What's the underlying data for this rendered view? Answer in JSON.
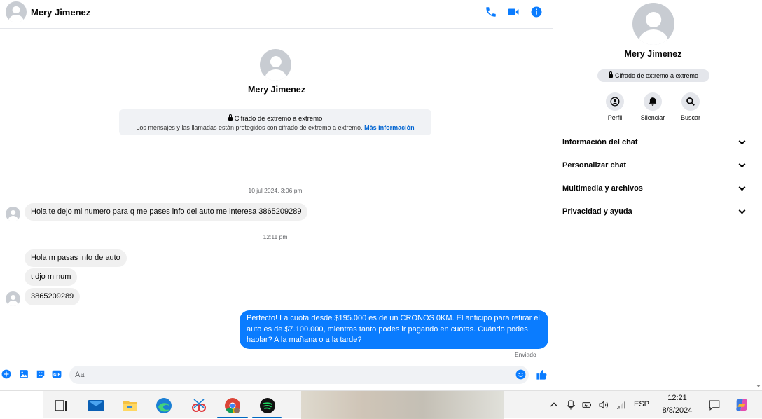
{
  "header": {
    "contact_name": "Mery Jimenez"
  },
  "chat": {
    "profile_name": "Mery Jimenez",
    "e2e_title": "Cifrado de extremo a extremo",
    "e2e_desc": "Los mensajes y las llamadas están protegidos con cifrado de extremo a extremo.",
    "e2e_link": "Más información",
    "timestamp1": "10 jul 2024, 3:06 pm",
    "timestamp2": "12:11 pm",
    "messages_in": [
      "Hola te dejo mi numero para q me pases  info del auto me interesa 3865209289",
      "Hola m pasas info de auto",
      "t djo m num",
      "3865209289"
    ],
    "message_out": "Perfecto! La cuota desde $195.000 es de un CRONOS 0KM. El anticipo para retirar el auto es de $7.100.000, mientras tanto podes ir pagando en cuotas. Cuándo podes hablar? A la mañana o a la tarde?",
    "sent_label": "Enviado",
    "composer_placeholder": "Aa"
  },
  "info_panel": {
    "name": "Mery Jimenez",
    "badge": "Cifrado de extremo a extremo",
    "actions": [
      "Perfil",
      "Silenciar",
      "Buscar"
    ],
    "sections": [
      "Información del chat",
      "Personalizar chat",
      "Multimedia y archivos",
      "Privacidad y ayuda"
    ]
  },
  "taskbar": {
    "language": "ESP",
    "time": "12:21",
    "date": "8/8/2024"
  },
  "colors": {
    "accent": "#0a7cff",
    "link": "#0064d1"
  }
}
